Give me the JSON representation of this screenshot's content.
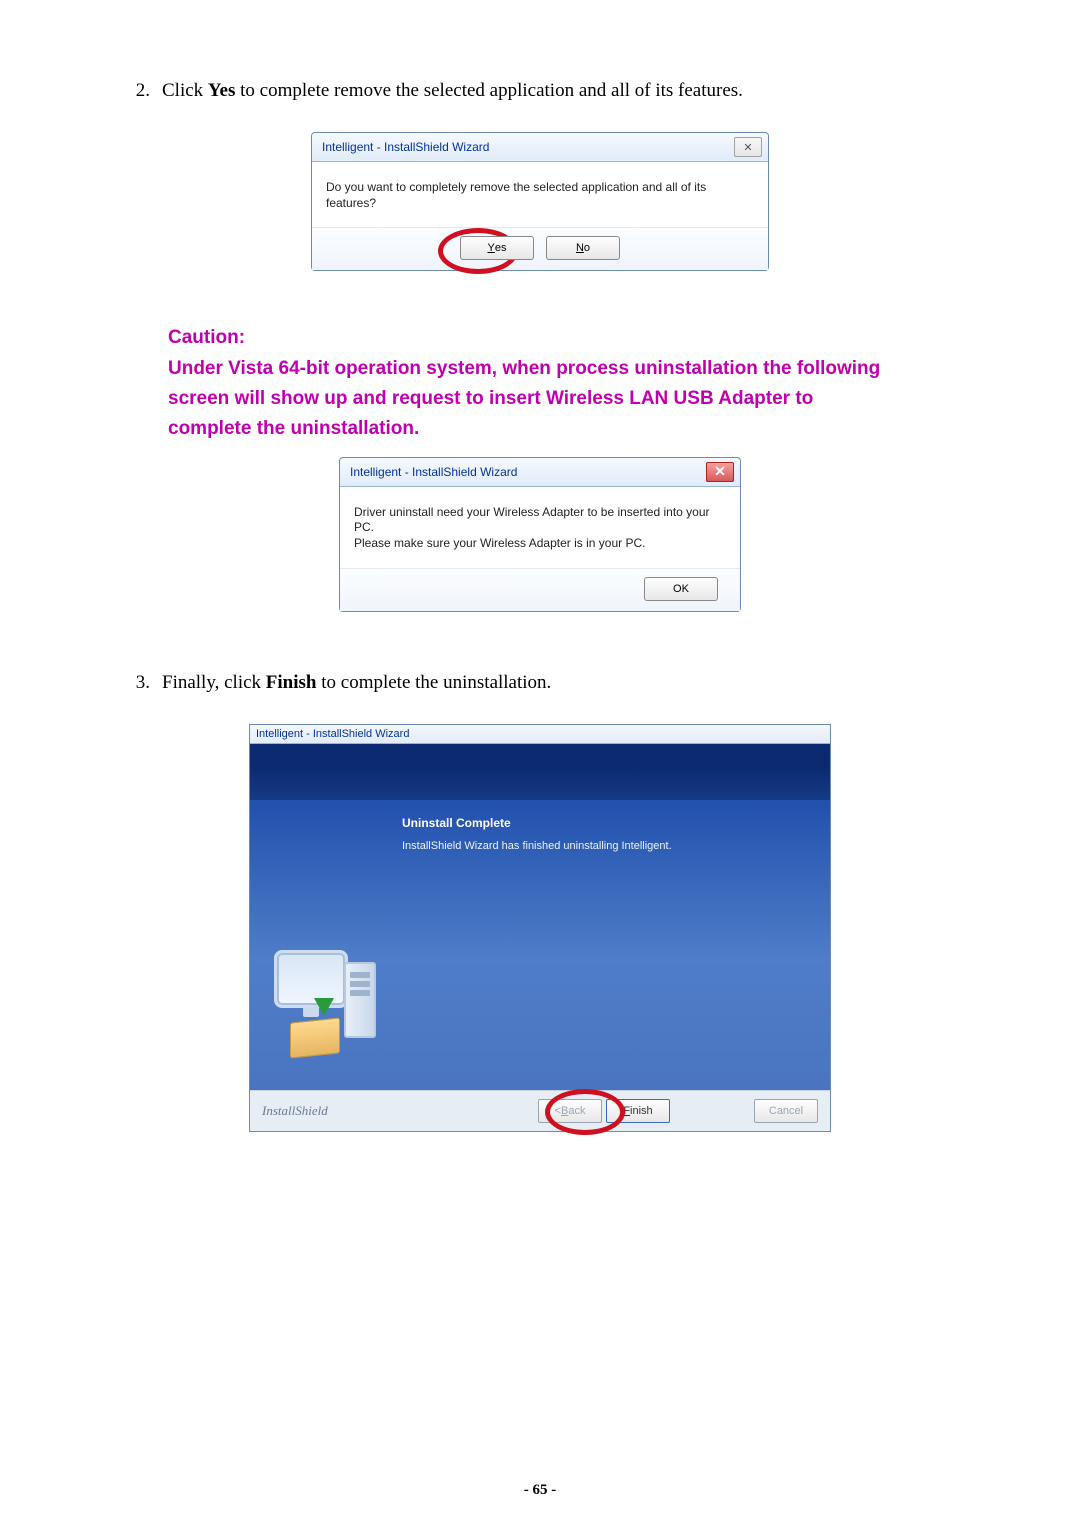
{
  "step2": {
    "num": "2.",
    "prefix": "Click ",
    "bold": "Yes",
    "suffix": " to complete remove the selected application and all of its features."
  },
  "dlg1": {
    "title": "Intelligent - InstallShield Wizard",
    "close_glyph": "✕",
    "message": "Do you want to completely remove the selected application and all of its features?",
    "yes_u": "Y",
    "yes_rest": "es",
    "no_u": "N",
    "no_rest": "o"
  },
  "caution": {
    "heading": "Caution:",
    "line": "Under Vista 64-bit operation system, when process uninstallation the following screen will show up and request to insert Wireless LAN USB Adapter to complete the uninstallation."
  },
  "dlg2": {
    "title": "Intelligent - InstallShield Wizard",
    "line1": "Driver uninstall need your Wireless Adapter to be inserted into your PC.",
    "line2": "Please make sure your Wireless Adapter is in your PC.",
    "ok": "OK"
  },
  "step3": {
    "num": "3.",
    "prefix": "Finally, click ",
    "bold": "Finish",
    "suffix": " to complete the uninstallation."
  },
  "wiz": {
    "title": "Intelligent - InstallShield Wizard",
    "heading": "Uninstall Complete",
    "body": "InstallShield Wizard has finished uninstalling Intelligent.",
    "brand": "InstallShield",
    "back_lt": "< ",
    "back_u": "B",
    "back_rest": "ack",
    "finish_u": "F",
    "finish_rest": "inish",
    "cancel": "Cancel"
  },
  "page_number": "- 65 -"
}
